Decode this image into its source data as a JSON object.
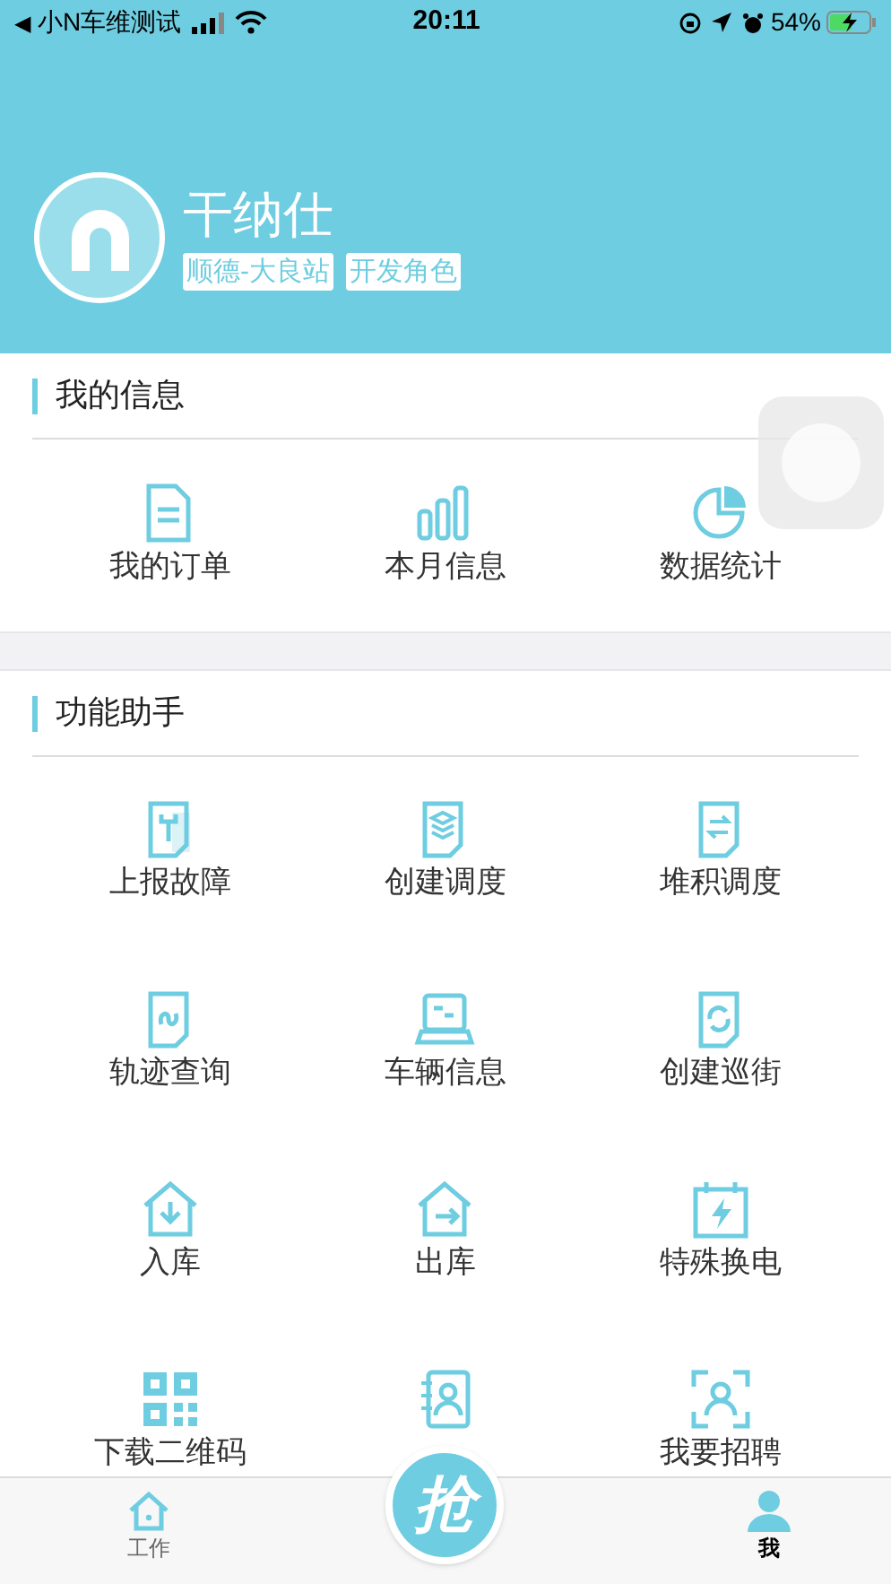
{
  "status_bar": {
    "back": "◀",
    "carrier": "小N车维测试",
    "time": "20:11",
    "battery": "54%"
  },
  "profile": {
    "name": "干纳仕",
    "tags": [
      "顺德-大良站",
      "开发角色"
    ]
  },
  "sections": [
    {
      "title": "我的信息",
      "items": [
        {
          "kind": "labeled",
          "label": "我的订单"
        },
        {
          "kind": "labeled",
          "label": "本月信息"
        },
        {
          "kind": "labeled",
          "label": "数据统计"
        }
      ]
    },
    {
      "title": "功能助手",
      "items": [
        {
          "kind": "labeled",
          "label": "上报故障"
        },
        {
          "kind": "labeled",
          "label": "创建调度"
        },
        {
          "kind": "labeled",
          "label": "堆积调度"
        },
        {
          "kind": "labeled",
          "label": "轨迹查询"
        },
        {
          "kind": "labeled",
          "label": "车辆信息"
        },
        {
          "kind": "labeled",
          "label": "创建巡街"
        },
        {
          "kind": "labeled",
          "label": "入库"
        },
        {
          "kind": "labeled",
          "label": "出库"
        },
        {
          "kind": "labeled",
          "label": "特殊换电"
        },
        {
          "kind": "labeled",
          "label": "下载二维码"
        },
        {
          "kind": "icon_only"
        },
        {
          "kind": "labeled",
          "label": "我要招聘"
        }
      ]
    }
  ],
  "tab_bar": {
    "tabs": [
      {
        "label": "工作",
        "selected": false
      },
      {
        "label": "我",
        "selected": true
      }
    ],
    "center_button": "抢"
  }
}
